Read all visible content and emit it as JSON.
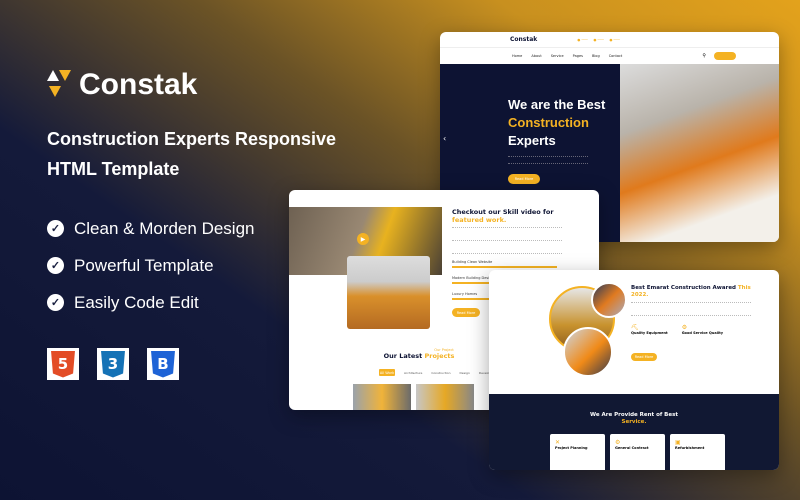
{
  "brand": {
    "name": "Constak",
    "accent": "#f4b223",
    "navy": "#0d1333"
  },
  "tagline": "Construction Experts Responsive HTML Template",
  "features": [
    {
      "label": "Clean & Morden Design",
      "icon": "check-icon"
    },
    {
      "label": "Powerful Template",
      "icon": "check-icon"
    },
    {
      "label": "Easily Code Edit",
      "icon": "check-icon"
    }
  ],
  "tech": [
    {
      "name": "html5-icon",
      "glyph": "5",
      "color": "#e34c26"
    },
    {
      "name": "css3-icon",
      "glyph": "3",
      "color": "#1572b6"
    },
    {
      "name": "bootstrap-icon",
      "glyph": "B",
      "color": "#1e63d6"
    }
  ],
  "preview1": {
    "logo": "Constak",
    "nav": [
      "Home",
      "About",
      "Service",
      "Pages",
      "Blog",
      "Contact"
    ],
    "hero_line1": "We are the Best",
    "hero_highlight": "Construction",
    "hero_line2": "Experts",
    "cta": "Read More"
  },
  "preview2": {
    "heading": "Checkout our Skill video for",
    "heading_highlight": "featured work.",
    "skills": [
      "Building Clean Website",
      "Modern Building Design",
      "Luxury Homes"
    ],
    "button": "Read More",
    "projects_subtitle": "Our Project",
    "projects_title": "Our Latest",
    "projects_highlight": "Projects",
    "filters": [
      "All Work",
      "Architecture",
      "Construction",
      "Design",
      "Development"
    ]
  },
  "preview3": {
    "heading": "Best Emarat Construction Awared",
    "heading_highlight": "This 2022.",
    "features": [
      "Quality Equipment",
      "Good Service Quality"
    ],
    "button": "Read More",
    "services_title": "We Are Provide Rent of Best",
    "services_highlight": "Service.",
    "services": [
      "Project Planning",
      "General Contract",
      "Refurbishment"
    ]
  }
}
